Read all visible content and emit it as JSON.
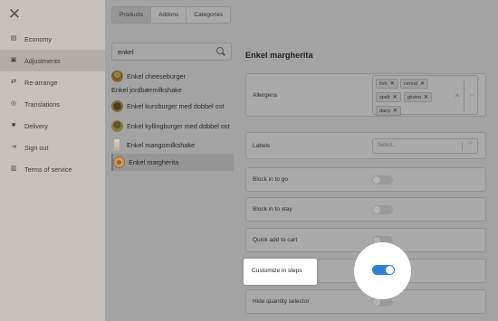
{
  "sidebar": {
    "items": [
      {
        "label": "Economy",
        "icon": "receipt-icon"
      },
      {
        "label": "Adjustments",
        "icon": "sliders-icon",
        "active": true
      },
      {
        "label": "Re-arrange",
        "icon": "shuffle-icon"
      },
      {
        "label": "Translations",
        "icon": "globe-icon"
      },
      {
        "label": "Delivery",
        "icon": "truck-icon"
      },
      {
        "label": "Sign out",
        "icon": "sign-out-icon"
      },
      {
        "label": "Terms of service",
        "icon": "document-icon"
      }
    ]
  },
  "tabs": [
    {
      "label": "Products",
      "active": true
    },
    {
      "label": "Addons"
    },
    {
      "label": "Categories"
    }
  ],
  "search": {
    "value": "enkel"
  },
  "results": [
    {
      "label": "Enkel cheeseburger"
    },
    {
      "label": "Enkel jordbærmilkshake"
    },
    {
      "label": "Enkel kuroburger med dobbel ost"
    },
    {
      "label": "Enkel kyllingburger med dobbel ost"
    },
    {
      "label": "Enkel mangomilkshake"
    },
    {
      "label": "Enkel margherita",
      "selected": true
    }
  ],
  "detail": {
    "title": "Enkel margherita",
    "allergens": {
      "label": "Allergens",
      "chips": [
        "fish",
        "cereal",
        "spelt",
        "gluten",
        "dairy"
      ]
    },
    "labels": {
      "label": "Labels",
      "placeholder": "Select..."
    },
    "toggles": [
      {
        "label": "Block in to go",
        "on": false
      },
      {
        "label": "Block in to stay",
        "on": false
      },
      {
        "label": "Quick add to cart",
        "on": false
      },
      {
        "label": "Customize in steps",
        "on": true
      },
      {
        "label": "Hide quantity selector",
        "on": false
      }
    ]
  },
  "colors": {
    "accent": "#2f80d0"
  }
}
